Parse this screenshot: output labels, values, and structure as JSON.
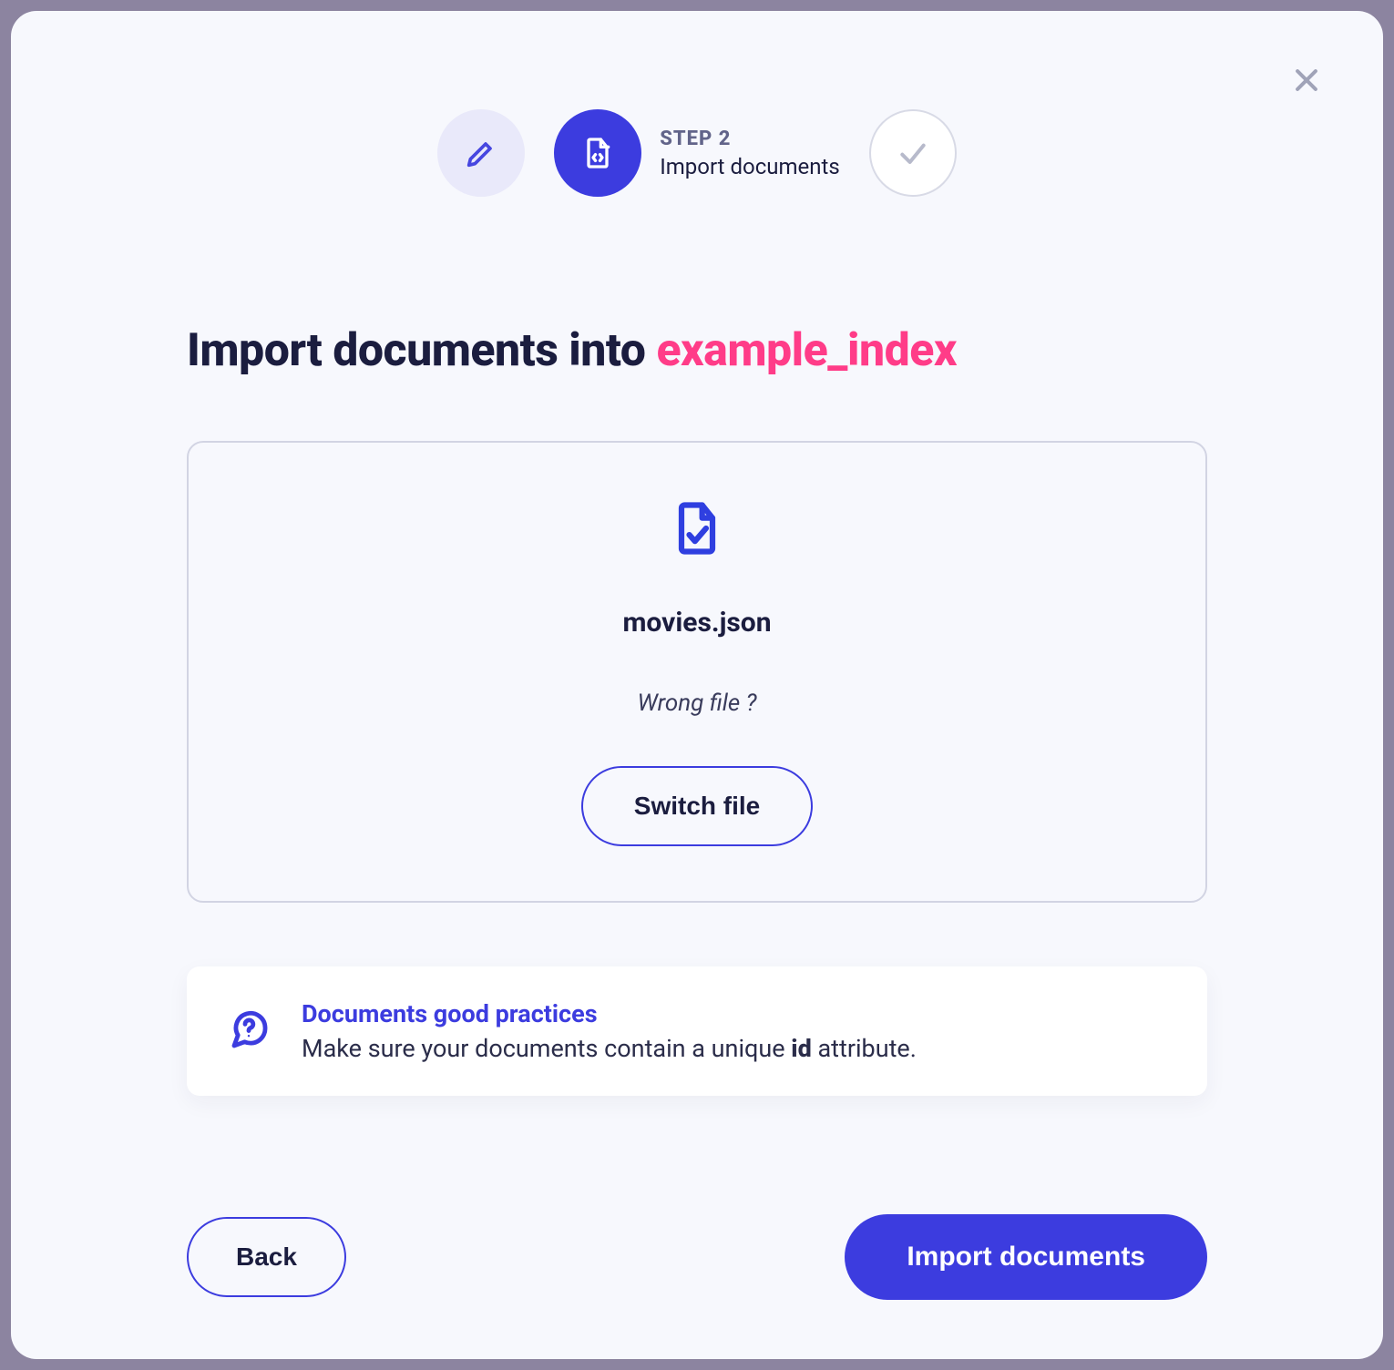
{
  "stepper": {
    "current_label": "STEP 2",
    "current_title": "Import documents"
  },
  "heading": {
    "prefix": "Import documents into ",
    "index_name": "example_index"
  },
  "file": {
    "name": "movies.json",
    "wrong_file_prompt": "Wrong file ?",
    "switch_label": "Switch file"
  },
  "info": {
    "title": "Documents good practices",
    "desc_before": "Make sure your documents contain a unique ",
    "desc_keyword": "id",
    "desc_after": " attribute."
  },
  "footer": {
    "back_label": "Back",
    "submit_label": "Import documents"
  }
}
